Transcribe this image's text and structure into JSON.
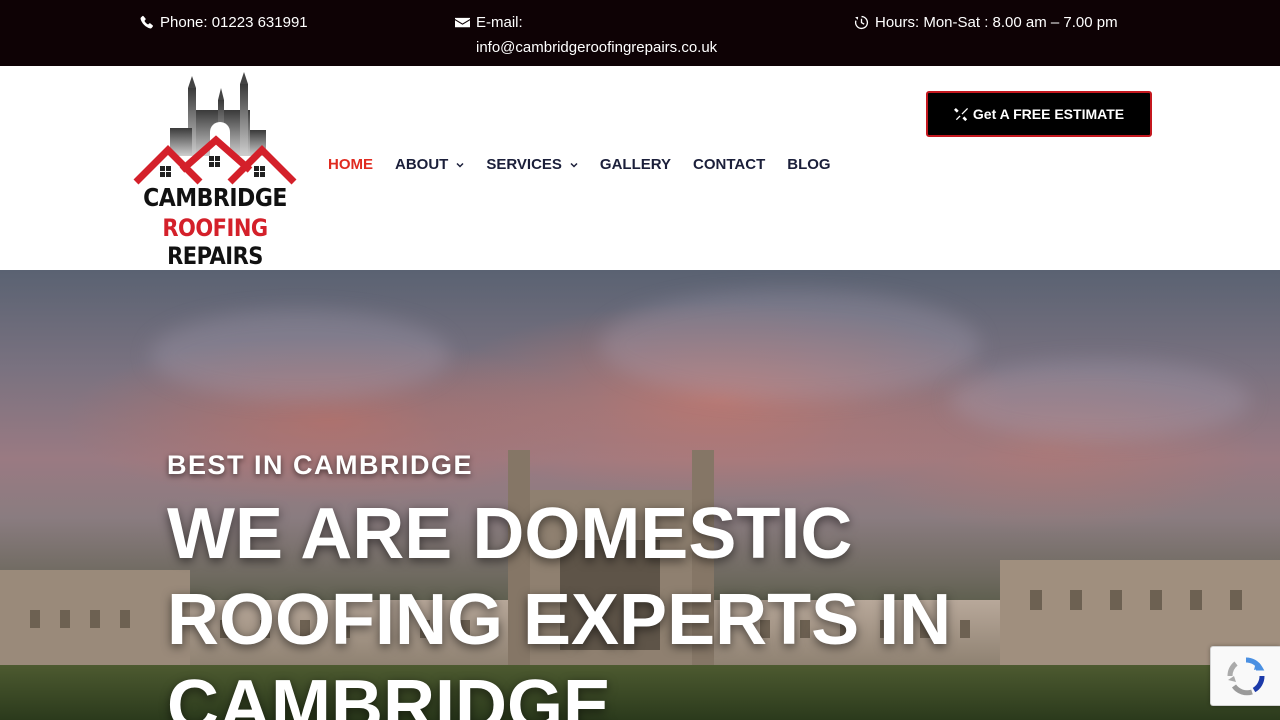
{
  "topbar": {
    "phone": "Phone: 01223 631991",
    "email_label": "E-mail:",
    "email_value": "info@cambridgeroofingrepairs.co.uk",
    "hours": "Hours: Mon-Sat : 8.00 am – 7.00 pm"
  },
  "logo": {
    "line1": "CAMBRIDGE",
    "line2a": "ROOFING",
    "line2b": "REPAIRS"
  },
  "nav": {
    "items": [
      {
        "label": "HOME"
      },
      {
        "label": "ABOUT"
      },
      {
        "label": "SERVICES"
      },
      {
        "label": "GALLERY"
      },
      {
        "label": "CONTACT"
      },
      {
        "label": "BLOG"
      }
    ]
  },
  "cta": {
    "label": "Get A FREE ESTIMATE"
  },
  "hero": {
    "subtitle": "BEST IN CAMBRIDGE",
    "title": "WE ARE DOMESTIC ROOFING EXPERTS IN CAMBRIDGE"
  },
  "colors": {
    "topbar_bg": "#0e0205",
    "accent_red": "#e02b20",
    "nav_text": "#1b1f3a"
  },
  "icons": {
    "phone": "phone-icon",
    "email": "envelope-icon",
    "hours": "clock-icon",
    "cta": "tools-icon",
    "recaptcha": "recaptcha-icon"
  }
}
